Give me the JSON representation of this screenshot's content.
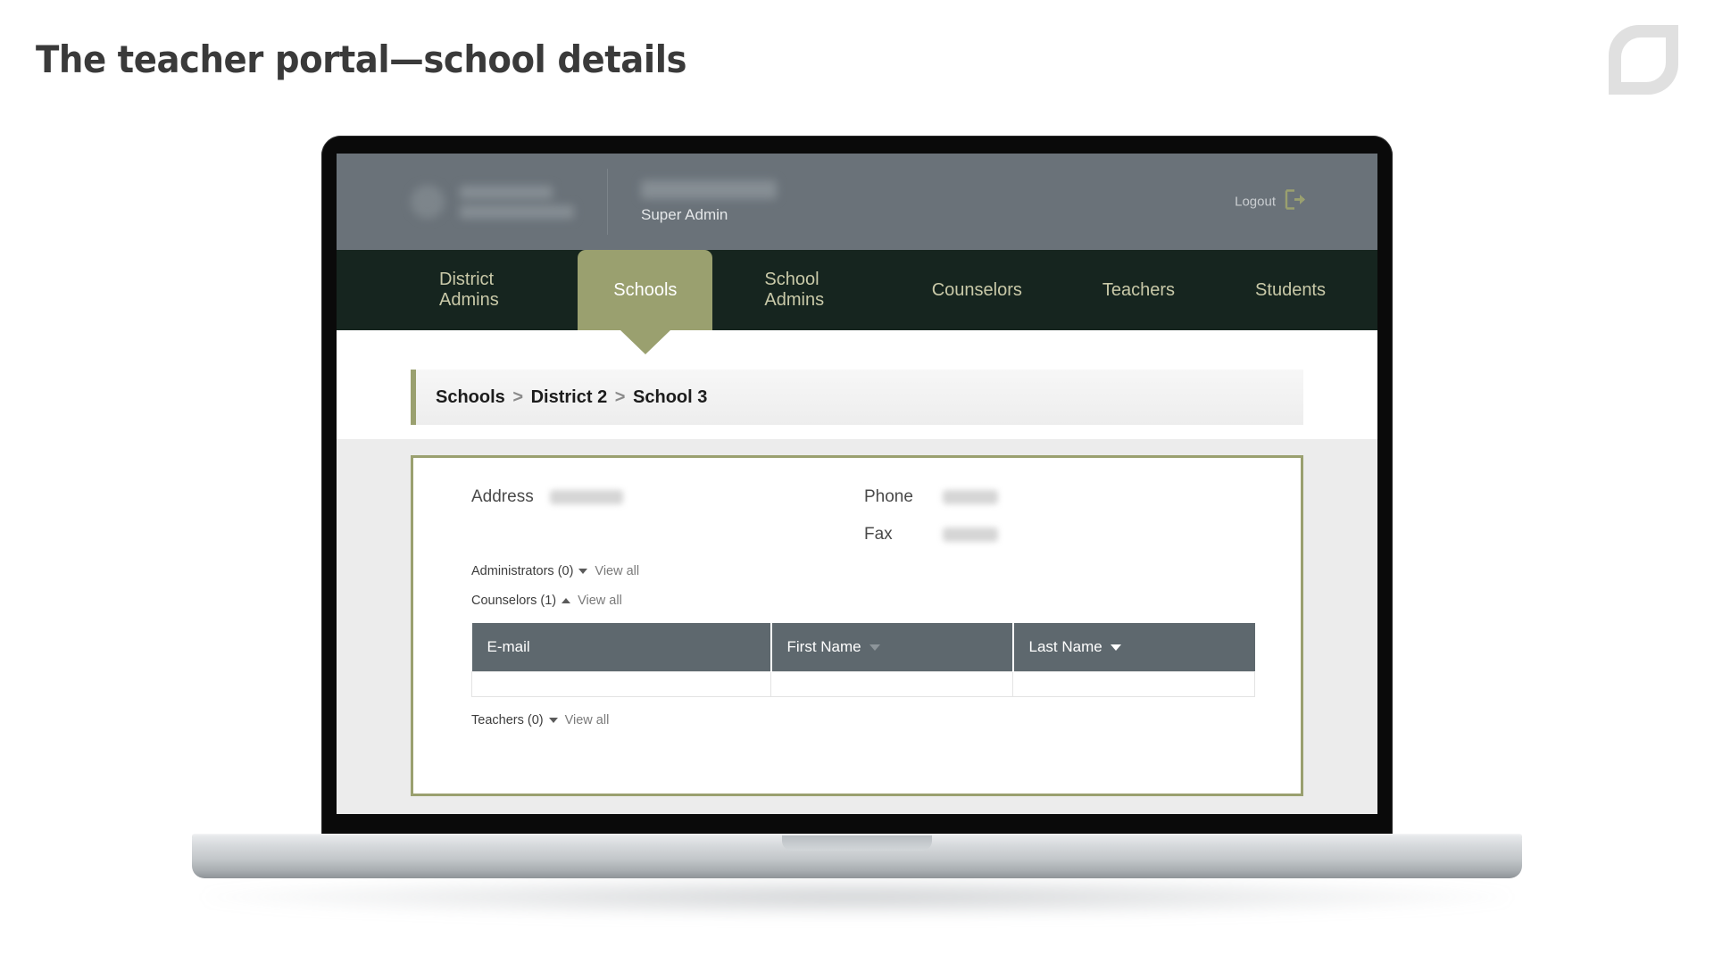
{
  "slide": {
    "title": "The teacher portal—school details",
    "logo_icon": "leaf-logo-icon"
  },
  "app": {
    "header": {
      "user_role": "Super Admin",
      "logout_label": "Logout",
      "logout_icon": "logout-arrow-icon",
      "org_logo_icon": "org-logo-icon"
    },
    "nav": {
      "tabs": [
        {
          "label": "District Admins",
          "active": false
        },
        {
          "label": "Schools",
          "active": true
        },
        {
          "label": "School Admins",
          "active": false
        },
        {
          "label": "Counselors",
          "active": false
        },
        {
          "label": "Teachers",
          "active": false
        },
        {
          "label": "Students",
          "active": false
        }
      ]
    },
    "breadcrumb": {
      "root": "Schools",
      "separator": ">",
      "district": "District 2",
      "school": "School 3"
    },
    "details": {
      "address_label": "Address",
      "phone_label": "Phone",
      "fax_label": "Fax",
      "groups": [
        {
          "label": "Administrators (0)",
          "caret": "down",
          "view_all": "View all"
        },
        {
          "label": "Counselors (1)",
          "caret": "up",
          "view_all": "View all"
        },
        {
          "label": "Teachers (0)",
          "caret": "down",
          "view_all": "View all"
        }
      ],
      "table": {
        "columns": [
          {
            "label": "E-mail",
            "sortable": false
          },
          {
            "label": "First Name",
            "sortable": true,
            "sort_state": "dim"
          },
          {
            "label": "Last Name",
            "sortable": true,
            "sort_state": "active"
          }
        ],
        "rows": [
          {
            "email": "",
            "first_name": "",
            "last_name": ""
          }
        ]
      }
    }
  },
  "colors": {
    "accent_olive": "#9aa06f",
    "nav_dark": "#16251f",
    "header_slate": "#6a7279",
    "table_header": "#5e686e",
    "page_bg": "#ececec"
  }
}
